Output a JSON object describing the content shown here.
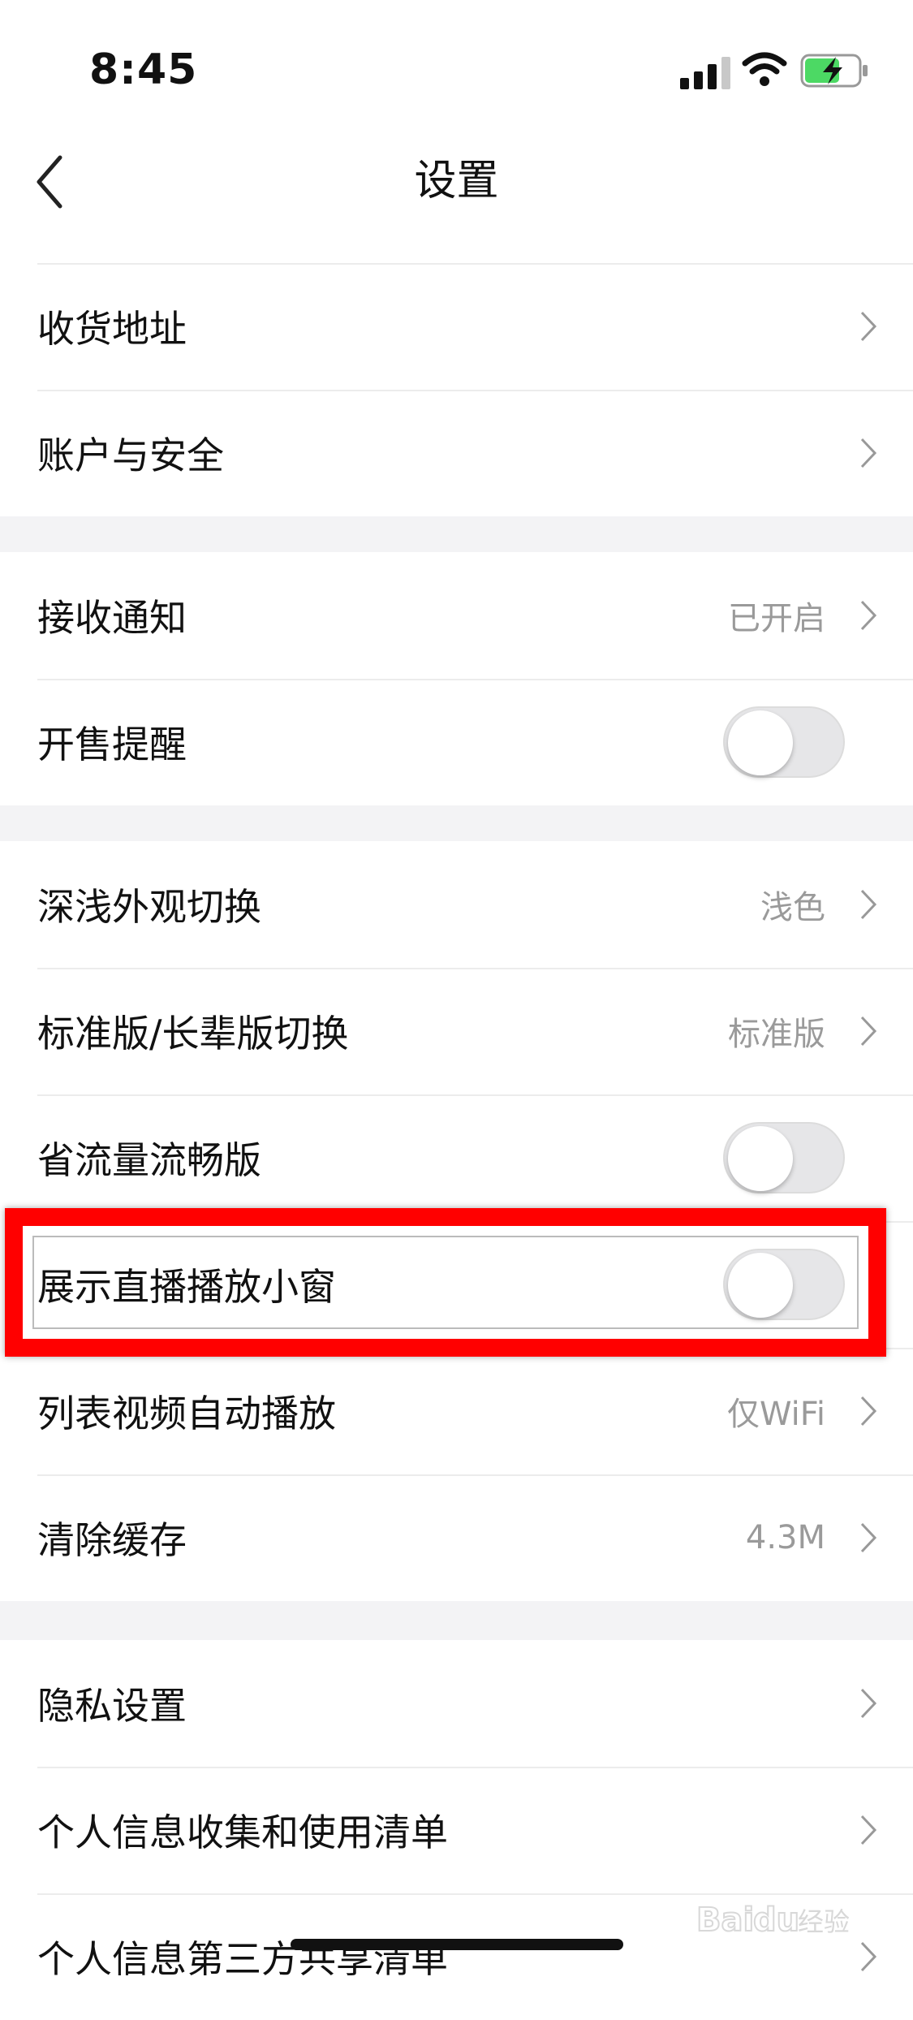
{
  "status_bar": {
    "time": "8:45",
    "battery_color": "#4cd964"
  },
  "navbar": {
    "title": "设置",
    "back_icon": "chevron-left-icon"
  },
  "sections": [
    {
      "items": [
        {
          "label": "收货地址",
          "value": "",
          "control": "chevron"
        },
        {
          "label": "账户与安全",
          "value": "",
          "control": "chevron"
        }
      ]
    },
    {
      "items": [
        {
          "label": "接收通知",
          "value": "已开启",
          "control": "chevron"
        },
        {
          "label": "开售提醒",
          "value": "",
          "control": "toggle",
          "on": false
        }
      ]
    },
    {
      "items": [
        {
          "label": "深浅外观切换",
          "value": "浅色",
          "control": "chevron"
        },
        {
          "label": "标准版/长辈版切换",
          "value": "标准版",
          "control": "chevron"
        },
        {
          "label": "省流量流畅版",
          "value": "",
          "control": "toggle",
          "on": false
        },
        {
          "label": "展示直播播放小窗",
          "value": "",
          "control": "toggle",
          "on": false
        },
        {
          "label": "列表视频自动播放",
          "value": "仅WiFi",
          "control": "chevron"
        },
        {
          "label": "清除缓存",
          "value": "4.3M",
          "control": "chevron"
        }
      ]
    },
    {
      "items": [
        {
          "label": "隐私设置",
          "value": "",
          "control": "chevron"
        },
        {
          "label": "个人信息收集和使用清单",
          "value": "",
          "control": "chevron"
        },
        {
          "label": "个人信息第三方共享清单",
          "value": "",
          "control": "chevron"
        }
      ]
    }
  ],
  "highlight": {
    "color": "#ff0000",
    "target": "展示直播播放小窗"
  },
  "watermark": {
    "text": "Baidu经验"
  }
}
